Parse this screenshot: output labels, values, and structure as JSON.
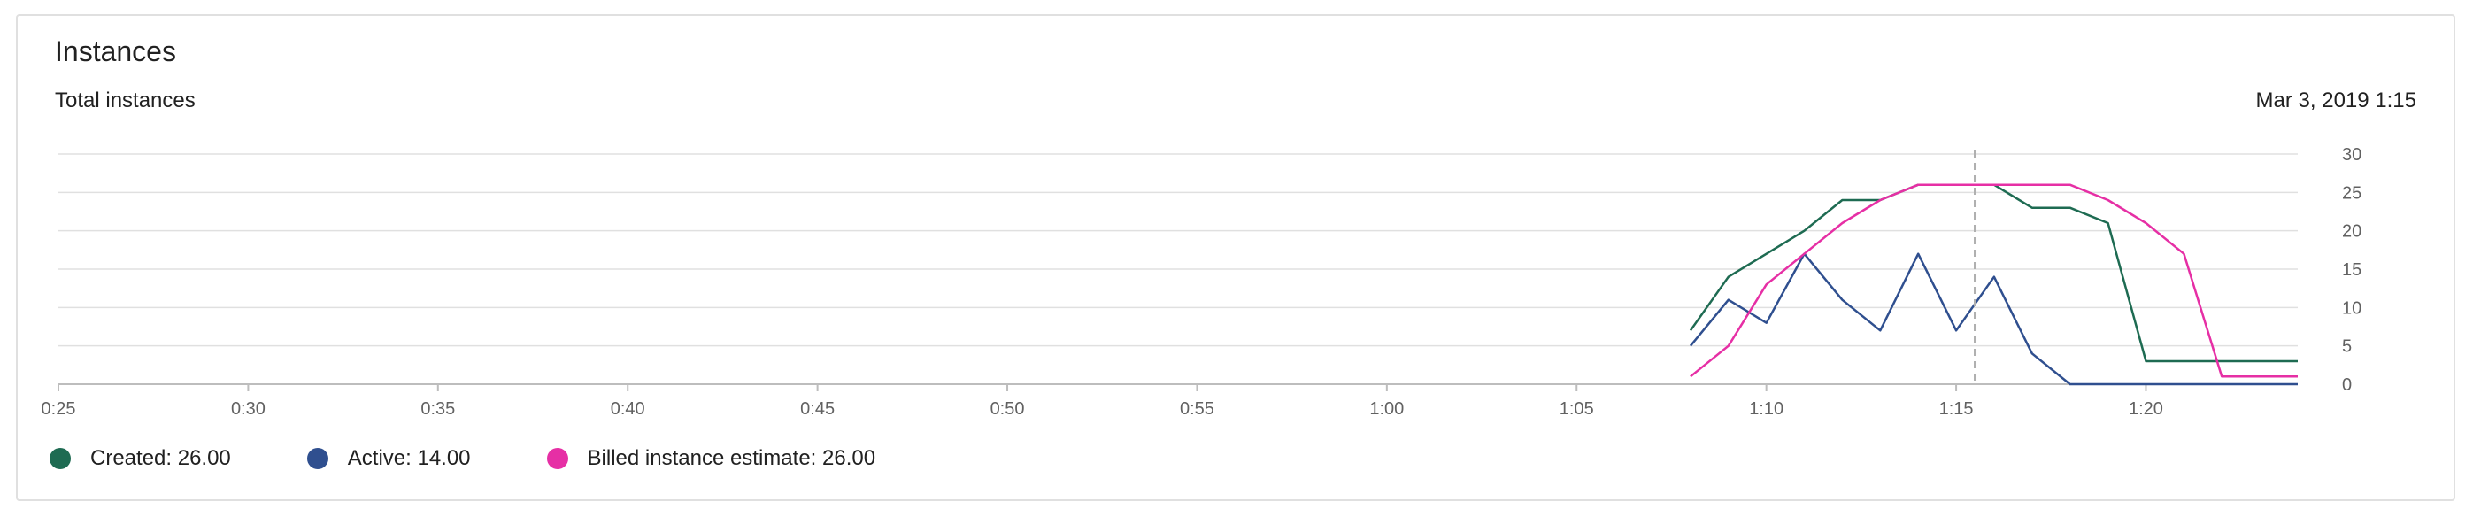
{
  "card": {
    "title": "Instances"
  },
  "chart_data": {
    "type": "line",
    "title": "Total instances",
    "timestamp": "Mar 3, 2019 1:15",
    "x_unit": "minutes",
    "xlim": [
      25,
      84
    ],
    "x_ticks": [
      {
        "value": 25,
        "label": "0:25"
      },
      {
        "value": 30,
        "label": "0:30"
      },
      {
        "value": 35,
        "label": "0:35"
      },
      {
        "value": 40,
        "label": "0:40"
      },
      {
        "value": 45,
        "label": "0:45"
      },
      {
        "value": 50,
        "label": "0:50"
      },
      {
        "value": 55,
        "label": "0:55"
      },
      {
        "value": 60,
        "label": "1:00"
      },
      {
        "value": 65,
        "label": "1:05"
      },
      {
        "value": 70,
        "label": "1:10"
      },
      {
        "value": 75,
        "label": "1:15"
      },
      {
        "value": 80,
        "label": "1:20"
      }
    ],
    "ylim": [
      0,
      30
    ],
    "y_ticks": [
      0,
      5,
      10,
      15,
      20,
      25,
      30
    ],
    "grid": true,
    "cursor_x": 75.5,
    "legend_position": "bottom-left",
    "series": [
      {
        "name": "Created",
        "legend_label": "Created: 26.00",
        "color": "#1e6b52",
        "x": [
          68,
          69,
          70,
          71,
          72,
          73,
          74,
          75,
          76,
          77,
          78,
          79,
          80,
          81,
          82,
          83,
          84
        ],
        "y": [
          7,
          14,
          17,
          20,
          24,
          24,
          26,
          26,
          26,
          23,
          23,
          21,
          3,
          3,
          3,
          3,
          3
        ]
      },
      {
        "name": "Active",
        "legend_label": "Active: 14.00",
        "color": "#2f4f8f",
        "x": [
          68,
          69,
          70,
          71,
          72,
          73,
          74,
          75,
          76,
          77,
          78,
          79,
          80,
          81,
          82,
          83,
          84
        ],
        "y": [
          5,
          11,
          8,
          17,
          11,
          7,
          17,
          7,
          14,
          4,
          0,
          0,
          0,
          0,
          0,
          0,
          0
        ]
      },
      {
        "name": "Billed instance estimate",
        "legend_label": "Billed instance estimate: 26.00",
        "color": "#e62fa5",
        "x": [
          68,
          69,
          70,
          71,
          72,
          73,
          74,
          75,
          76,
          77,
          78,
          79,
          80,
          81,
          82,
          83,
          84
        ],
        "y": [
          1,
          5,
          13,
          17,
          21,
          24,
          26,
          26,
          26,
          26,
          26,
          24,
          21,
          17,
          1,
          1,
          1
        ]
      }
    ]
  },
  "colors": {
    "grid": "#e0e0e0",
    "axis": "#bdbdbd",
    "cursor": "#b0b0b0",
    "tick_text": "#616161"
  }
}
